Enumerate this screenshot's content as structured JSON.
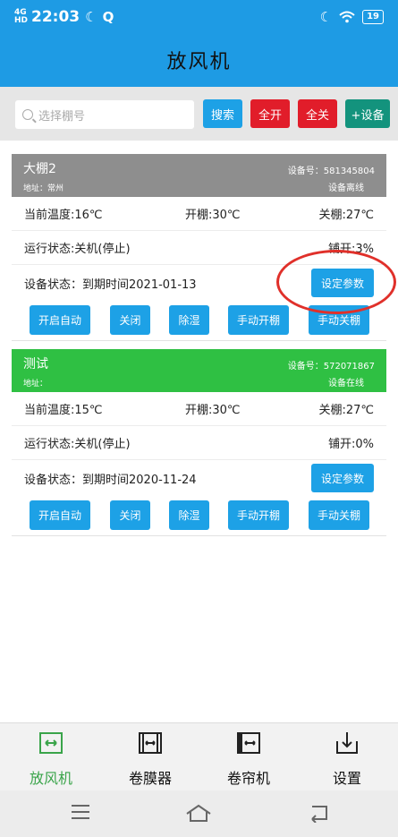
{
  "status_bar": {
    "network": "4G",
    "hd": "HD",
    "time": "22:03",
    "battery": "19"
  },
  "app_title": "放风机",
  "toolbar": {
    "search_placeholder": "选择棚号",
    "search_button": "搜索",
    "all_on": "全开",
    "all_off": "全关",
    "add_device": "+设备"
  },
  "devices": [
    {
      "name": "大棚2",
      "address_label": "地址：常州",
      "device_no": "设备号：581345804",
      "device_status_short": "设备离线",
      "current_temp": "当前温度:16℃",
      "open_temp": "开棚:30℃",
      "close_temp": "关棚:27℃",
      "run_state": "运行状态:关机(停止)",
      "spread": "铺开:3%",
      "device_state": "设备状态：到期时间2021-01-13",
      "settings_button": "设定参数",
      "actions": [
        "开启自动",
        "关闭",
        "除湿",
        "手动开棚",
        "手动关棚"
      ]
    },
    {
      "name": "测试",
      "address_label": "地址：",
      "device_no": "设备号：572071867",
      "device_status_short": "设备在线",
      "current_temp": "当前温度:15℃",
      "open_temp": "开棚:30℃",
      "close_temp": "关棚:27℃",
      "run_state": "运行状态:关机(停止)",
      "spread": "铺开:0%",
      "device_state": "设备状态：到期时间2020-11-24",
      "settings_button": "设定参数",
      "actions": [
        "开启自动",
        "关闭",
        "除湿",
        "手动开棚",
        "手动关棚"
      ]
    }
  ],
  "tabs": [
    {
      "label": "放风机",
      "icon": "fan-icon",
      "active": true
    },
    {
      "label": "卷膜器",
      "icon": "film-roller-icon",
      "active": false
    },
    {
      "label": "卷帘机",
      "icon": "curtain-roller-icon",
      "active": false
    },
    {
      "label": "设置",
      "icon": "settings-download-icon",
      "active": false
    }
  ],
  "colors": {
    "primary": "#1e9be4",
    "button_blue": "#1da1e6",
    "danger": "#e11d2a",
    "teal": "#13937d",
    "offline_grey": "#8e8e8e",
    "online_green": "#2fc043",
    "active_tab": "#3aa44a",
    "annotation_red": "#e0302a"
  }
}
